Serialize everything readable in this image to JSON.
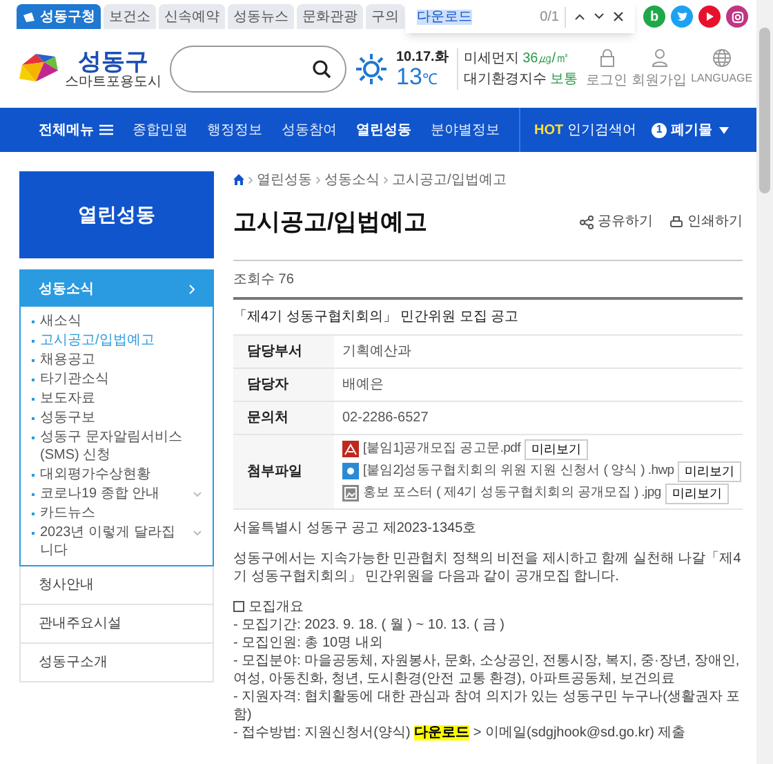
{
  "top_tabs": [
    {
      "label": "성동구청",
      "selected": true
    },
    {
      "label": "보건소",
      "selected": false
    },
    {
      "label": "신속예약",
      "selected": false
    },
    {
      "label": "성동뉴스",
      "selected": false
    },
    {
      "label": "문화관광",
      "selected": false
    },
    {
      "label": "구의",
      "selected": false
    }
  ],
  "social": [
    {
      "kind": "blog",
      "label": "b",
      "color": "#1ea84a"
    },
    {
      "kind": "twitter",
      "color": "#1da1f2"
    },
    {
      "kind": "youtube",
      "color": "#e8112d"
    },
    {
      "kind": "instagram",
      "color": "#c13584"
    }
  ],
  "find_bar": {
    "value": "다운로드",
    "count": "0/1"
  },
  "logo": {
    "name": "성동구",
    "slogan": "스마트포용도시"
  },
  "weather": {
    "date": "10.17.화",
    "temp": "13",
    "unit": "℃",
    "dust_label": "미세먼지",
    "dust_value": "36㎍/㎥",
    "air_label": "대기환경지수",
    "air_value": "보통"
  },
  "user_links": [
    {
      "kind": "lock",
      "label": "로그인"
    },
    {
      "kind": "person",
      "label": "회원가입"
    },
    {
      "kind": "globe",
      "label": "LANGUAGE"
    }
  ],
  "nav": {
    "all_menu": "전체메뉴",
    "items": [
      {
        "label": "종합민원",
        "selected": false
      },
      {
        "label": "행정정보",
        "selected": false
      },
      {
        "label": "성동참여",
        "selected": false
      },
      {
        "label": "열린성동",
        "selected": true
      },
      {
        "label": "분야별정보",
        "selected": false
      }
    ],
    "hot_badge": "HOT",
    "hot_label": "인기검색어",
    "hot_rank": "1",
    "hot_term": "폐기물"
  },
  "sidebar": {
    "title": "열린성동",
    "section": "성동소식",
    "items": [
      {
        "label": "새소식",
        "selected": false,
        "expandable": false
      },
      {
        "label": "고시공고/입법예고",
        "selected": true,
        "expandable": false
      },
      {
        "label": "채용공고",
        "selected": false,
        "expandable": false
      },
      {
        "label": "타기관소식",
        "selected": false,
        "expandable": false
      },
      {
        "label": "보도자료",
        "selected": false,
        "expandable": false
      },
      {
        "label": "성동구보",
        "selected": false,
        "expandable": false
      },
      {
        "label": "성동구 문자알림서비스(SMS) 신청",
        "selected": false,
        "expandable": false
      },
      {
        "label": "대외평가수상현황",
        "selected": false,
        "expandable": false
      },
      {
        "label": "코로나19 종합 안내",
        "selected": false,
        "expandable": true
      },
      {
        "label": "카드뉴스",
        "selected": false,
        "expandable": false
      },
      {
        "label": "2023년 이렇게 달라집니다",
        "selected": false,
        "expandable": true
      }
    ],
    "menus": [
      "청사안내",
      "관내주요시설",
      "성동구소개"
    ]
  },
  "breadcrumb": [
    "열린성동",
    "성동소식",
    "고시공고/입법예고"
  ],
  "page_title": "고시공고/입법예고",
  "actions": [
    {
      "kind": "share",
      "label": "공유하기"
    },
    {
      "kind": "print",
      "label": "인쇄하기"
    }
  ],
  "views": "조회수 76",
  "post_title": "「제4기 성동구협치회의」 민간위원 모집 공고",
  "info": [
    {
      "label": "담당부서",
      "value": "기획예산과"
    },
    {
      "label": "담당자",
      "value": "배예은"
    },
    {
      "label": "문의처",
      "value": "02-2286-6527"
    }
  ],
  "attachments_label": "첨부파일",
  "attachments": [
    {
      "kind": "pdf",
      "name": "[붙임1]공개모집 공고문.pdf",
      "button": "미리보기"
    },
    {
      "kind": "hwp",
      "name": "[붙임2]성동구협치회의 위원 지원 신청서 ( 양식 ) .hwp",
      "button": "미리보기"
    },
    {
      "kind": "image",
      "name": "홍보 포스터 ( 제4기 성동구협치회의 공개모집 ) .jpg",
      "button": "미리보기"
    }
  ],
  "body": [
    {
      "kind": "para",
      "text": "서울특별시 성동구 공고 제2023-1345호"
    },
    {
      "kind": "para",
      "text": "성동구에서는 지속가능한 민관협치 정책의 비전을 제시하고 함께 실천해 나갈「제4기 성동구협치회의」 민간위원을 다음과 같이 공개모집 합니다."
    },
    {
      "kind": "heading",
      "text": "모집개요"
    },
    {
      "kind": "line",
      "text": "- 모집기간: 2023. 9. 18. ( 월 ) ~ 10. 13. ( 금 )"
    },
    {
      "kind": "line",
      "text": "- 모집인원: 총 10명 내외"
    },
    {
      "kind": "line",
      "text": "- 모집분야: 마을공동체, 자원봉사, 문화, 소상공인, 전통시장, 복지, 중·장년, 장애인, 여성, 아동친화, 청년, 도시환경(안전 교통 환경), 아파트공동체, 보건의료"
    },
    {
      "kind": "line",
      "text": "- 지원자격: 협치활동에 대한 관심과 참여 의지가 있는 성동구민 누구나(생활권자 포함)"
    },
    {
      "kind": "highlighted",
      "before": "- 접수방법: 지원신청서(양식) ",
      "mark": "다운로드",
      "after": " > 이메일(sdgjhook@sd.go.kr) 제출"
    }
  ]
}
